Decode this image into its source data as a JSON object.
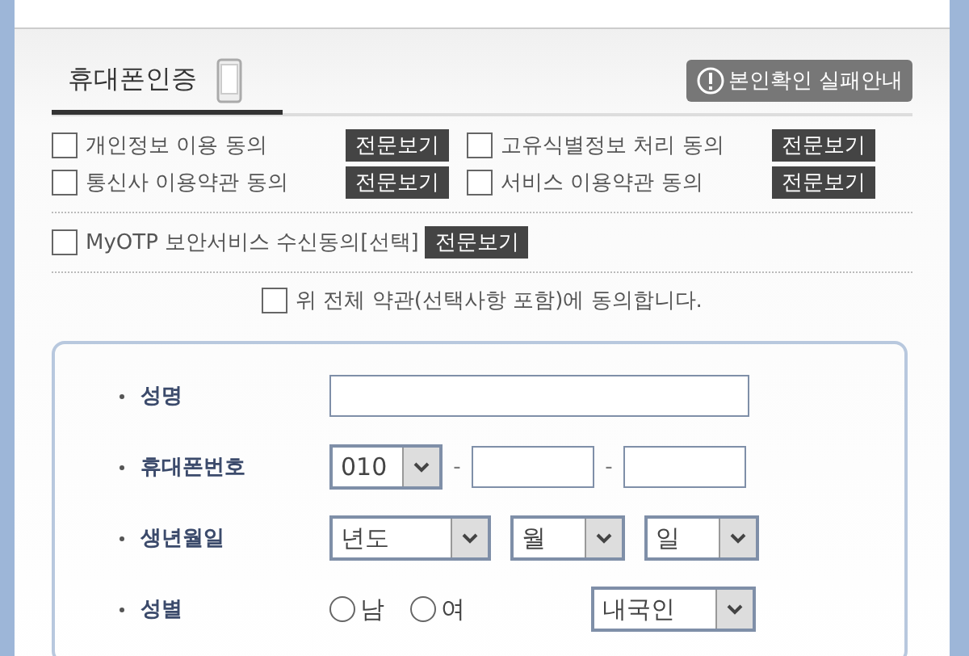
{
  "tab": {
    "label": "휴대폰인증",
    "selected": true
  },
  "help_button": {
    "label": "본인확인 실패안내"
  },
  "agreements": [
    {
      "label": "개인정보 이용 동의",
      "checked": false,
      "button": "전문보기"
    },
    {
      "label": "고유식별정보 처리 동의",
      "checked": false,
      "button": "전문보기"
    },
    {
      "label": "통신사 이용약관 동의",
      "checked": false,
      "button": "전문보기"
    },
    {
      "label": "서비스 이용약관 동의",
      "checked": false,
      "button": "전문보기"
    }
  ],
  "optional_agreement": {
    "label": "MyOTP 보안서비스 수신동의[선택]",
    "checked": false,
    "button": "전문보기"
  },
  "agree_all": {
    "label": "위 전체 약관(선택사항 포함)에 동의합니다.",
    "checked": false
  },
  "form": {
    "name": {
      "label": "성명"
    },
    "phone": {
      "label": "휴대폰번호",
      "prefix": "010",
      "separator": "-"
    },
    "birth": {
      "label": "생년월일",
      "year": "년도",
      "month": "월",
      "day": "일"
    },
    "gender": {
      "label": "성별",
      "options": [
        {
          "label": "남",
          "selected": false
        },
        {
          "label": "여",
          "selected": false
        }
      ],
      "nationality": "내국인"
    }
  }
}
